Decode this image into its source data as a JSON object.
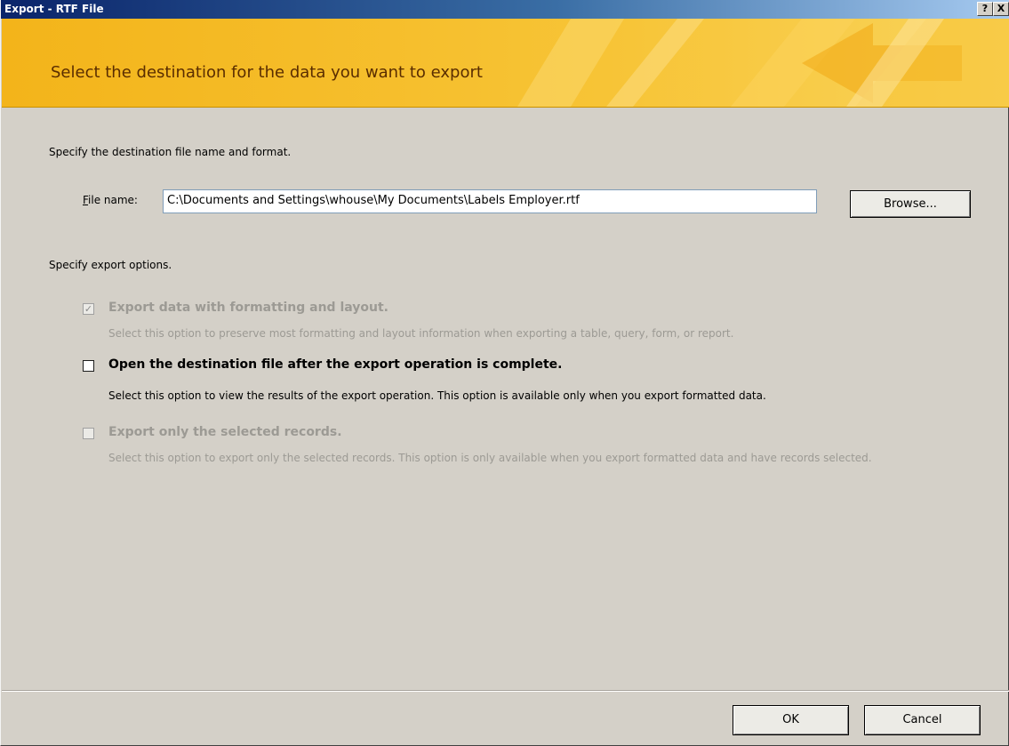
{
  "window": {
    "title": "Export - RTF File",
    "help_button": "?",
    "close_button": "X"
  },
  "banner": {
    "title": "Select the destination for the data you want to export"
  },
  "destination": {
    "heading": "Specify the destination file name and format.",
    "file_label_accel": "F",
    "file_label_rest": "ile name:",
    "file_value": "C:\\Documents and Settings\\whouse\\My Documents\\Labels Employer.rtf",
    "browse_label": "Browse..."
  },
  "options": {
    "heading": "Specify export options.",
    "items": [
      {
        "title": "Export data with formatting and layout.",
        "description": "Select this option to preserve most formatting and layout information when exporting a table, query, form, or report.",
        "checked": true,
        "enabled": false
      },
      {
        "title": "Open the destination file after the export operation is complete.",
        "description": "Select this option to view the results of the export operation. This option is available only when you export formatted data.",
        "checked": false,
        "enabled": true
      },
      {
        "title": "Export only the selected records.",
        "description": "Select this option to export only the selected records. This option is only available when you export formatted data and have records selected.",
        "checked": false,
        "enabled": false
      }
    ]
  },
  "footer": {
    "ok_label": "OK",
    "cancel_label": "Cancel"
  },
  "colors": {
    "banner": "#f5b820",
    "banner_text": "#5a2d00",
    "dialog_bg": "#d4d0c8",
    "titlebar": "#0a246a"
  }
}
